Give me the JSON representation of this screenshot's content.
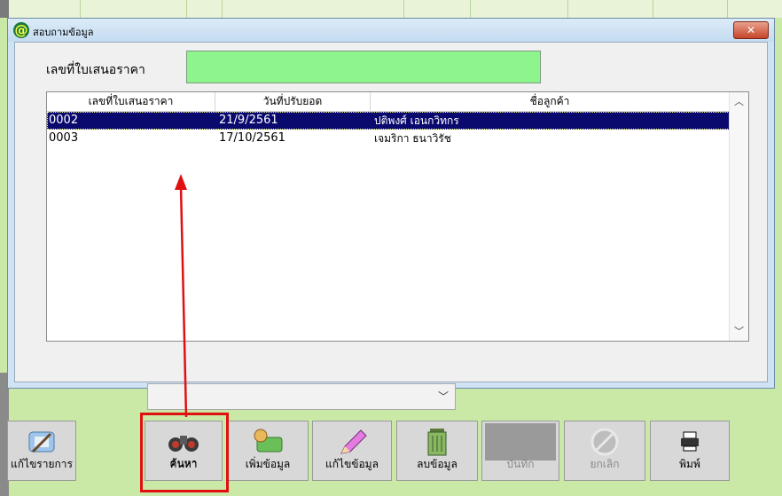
{
  "window": {
    "title": "สอบถามข้อมูล",
    "close_label": "✕"
  },
  "form": {
    "quote_label": "เลขที่ใบเสนอราคา",
    "quote_value": ""
  },
  "list": {
    "columns": [
      "เลขที่ใบเสนอราคา",
      "วันที่ปรับยอด",
      "ชื่อลูกค้า"
    ],
    "rows": [
      {
        "id": "0002",
        "date": "21/9/2561",
        "customer": "ปติพงศ์ เอนกวิทกร"
      },
      {
        "id": "0003",
        "date": "17/10/2561",
        "customer": "เจมริกา ธนาวิรัช"
      }
    ],
    "selected_index": 0
  },
  "combo": {
    "value": ""
  },
  "toolbar": {
    "edit_items": "แก้ไขรายการ",
    "search_hint": "ค้นหา",
    "search": "ค้นหา",
    "add": "เพิ่มข้อมูล",
    "edit": "แก้ไขข้อมูล",
    "delete": "ลบข้อมูล",
    "save": "บันทึก",
    "cancel": "ยกเลิก",
    "print": "พิมพ์"
  },
  "colors": {
    "selection": "#0a0a6e",
    "input_bg": "#8ef48e",
    "annotation": "#e01010"
  }
}
